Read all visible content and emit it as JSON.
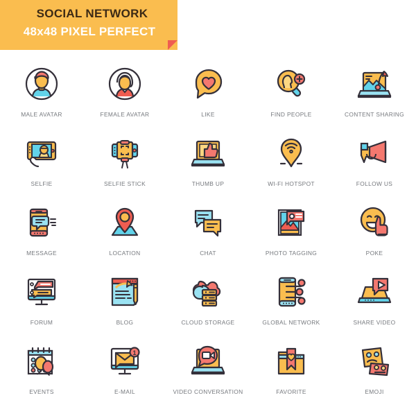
{
  "banner": {
    "line1": "SOCIAL NETWORK",
    "line2": "48x48 PIXEL PERFECT",
    "bg_color": "#fabd4f",
    "line1_color": "#3c2a15",
    "line2_color": "#ffffff",
    "fold_color": "#ef5d51"
  },
  "palette": {
    "outline": "#34303a",
    "yellow": "#fabd4f",
    "yellow_light": "#fdd782",
    "red": "#ef5d51",
    "red_light": "#f4786f",
    "cyan": "#62d3ea",
    "cyan_light": "#9ae2f2",
    "white": "#ffffff",
    "label": "#76797e"
  },
  "grid": {
    "columns": 5,
    "rows": 5,
    "icon_size": "48x48"
  },
  "icons": [
    {
      "id": "male-avatar",
      "label": "MALE AVATAR"
    },
    {
      "id": "female-avatar",
      "label": "FEMALE AVATAR"
    },
    {
      "id": "like",
      "label": "LIKE"
    },
    {
      "id": "find-people",
      "label": "FIND PEOPLE"
    },
    {
      "id": "content-sharing",
      "label": "CONTENT SHARING"
    },
    {
      "id": "selfie",
      "label": "SELFIE"
    },
    {
      "id": "selfie-stick",
      "label": "SELFIE STICK"
    },
    {
      "id": "thumb-up",
      "label": "THUMB UP"
    },
    {
      "id": "wifi-hotspot",
      "label": "WI-FI HOTSPOT"
    },
    {
      "id": "follow-us",
      "label": "FOLLOW US"
    },
    {
      "id": "message",
      "label": "MESSAGE"
    },
    {
      "id": "location",
      "label": "LOCATION"
    },
    {
      "id": "chat",
      "label": "CHAT"
    },
    {
      "id": "photo-tagging",
      "label": "PHOTO TAGGING"
    },
    {
      "id": "poke",
      "label": "POKE"
    },
    {
      "id": "forum",
      "label": "FORUM"
    },
    {
      "id": "blog",
      "label": "BLOG"
    },
    {
      "id": "cloud-storage",
      "label": "CLOUD STORAGE"
    },
    {
      "id": "global-network",
      "label": "GLOBAL NETWORK"
    },
    {
      "id": "share-video",
      "label": "SHARE VIDEO"
    },
    {
      "id": "events",
      "label": "EVENTS"
    },
    {
      "id": "e-mail",
      "label": "E-MAIL"
    },
    {
      "id": "video-conversation",
      "label": "VIDEO CONVERSATION"
    },
    {
      "id": "favorite",
      "label": "FAVORITE"
    },
    {
      "id": "emoji",
      "label": "EMOJI"
    }
  ],
  "email_badge_count": "1"
}
